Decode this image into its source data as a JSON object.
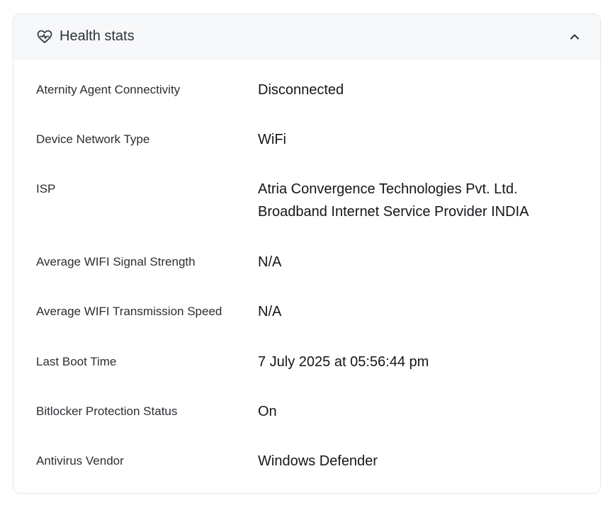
{
  "panel": {
    "title": "Health stats",
    "icon": "heart-pulse-icon",
    "collapse_icon": "chevron-up-icon"
  },
  "stats": [
    {
      "label": "Aternity Agent Connectivity",
      "value": "Disconnected"
    },
    {
      "label": "Device Network Type",
      "value": "WiFi"
    },
    {
      "label": "ISP",
      "value": "Atria Convergence Technologies Pvt. Ltd.",
      "value_line2": "Broadband Internet Service Provider INDIA"
    },
    {
      "label": "Average WIFI Signal Strength",
      "value": "N/A"
    },
    {
      "label": "Average WIFI Transmission Speed",
      "value": "N/A"
    },
    {
      "label": "Last Boot Time",
      "value": "7 July 2025 at 05:56:44 pm"
    },
    {
      "label": "Bitlocker Protection Status",
      "value": "On"
    },
    {
      "label": "Antivirus Vendor",
      "value": "Windows Defender"
    }
  ]
}
